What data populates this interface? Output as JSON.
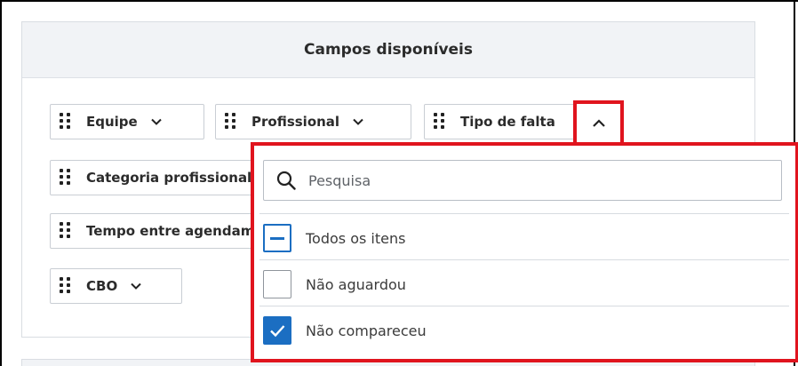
{
  "panel": {
    "title": "Campos disponíveis"
  },
  "chips": [
    {
      "label": "Equipe"
    },
    {
      "label": "Profissional"
    },
    {
      "label": "Tipo de falta"
    },
    {
      "label": "Categoria profissional"
    },
    {
      "label": "Tempo entre agendamento"
    },
    {
      "label": "CBO"
    }
  ],
  "dropdown": {
    "search_placeholder": "Pesquisa",
    "options": [
      {
        "label": "Todos os itens",
        "state": "partial"
      },
      {
        "label": "Não aguardou",
        "state": "unchecked"
      },
      {
        "label": "Não compareceu",
        "state": "checked"
      }
    ]
  },
  "colors": {
    "highlight": "#e0141e",
    "accent": "#1b6ec2"
  }
}
